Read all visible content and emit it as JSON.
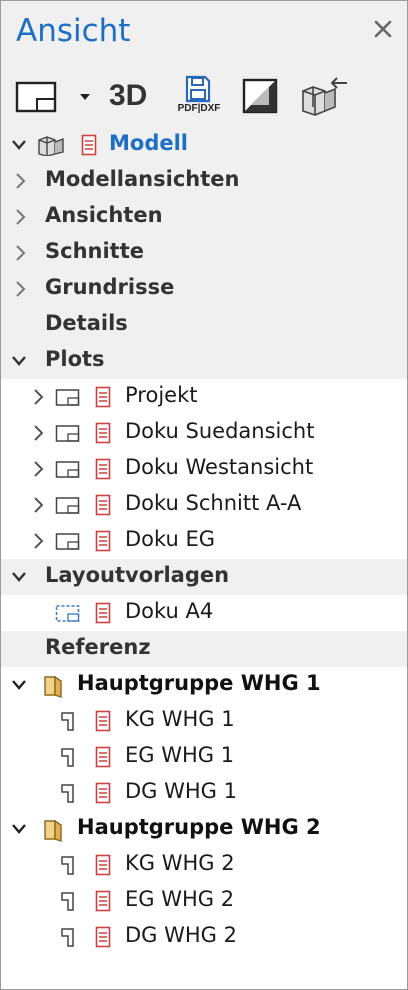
{
  "panel": {
    "title": "Ansicht",
    "close_icon": "close-icon"
  },
  "toolbar": {
    "layout_icon": "layout-view-icon",
    "dropdown_icon": "dropdown-arrow-icon",
    "view3d_label": "3D",
    "pdf_label": "PDF|DXF",
    "pdf_icon": "save-disk-icon",
    "contrast_icon": "contrast-icon",
    "model_export_icon": "model-export-icon"
  },
  "tree": {
    "modell": "Modell",
    "modellansichten": "Modellansichten",
    "ansichten": "Ansichten",
    "schnitte": "Schnitte",
    "grundrisse": "Grundrisse",
    "details": "Details",
    "plots": "Plots",
    "plot_items": [
      "Projekt",
      "Doku Suedansicht",
      "Doku Westansicht",
      "Doku Schnitt A-A",
      "Doku EG"
    ],
    "layoutvorlagen": "Layoutvorlagen",
    "layout_items": [
      "Doku A4"
    ],
    "referenz": "Referenz",
    "groups": [
      {
        "name": "Hauptgruppe WHG 1",
        "items": [
          "KG WHG 1",
          "EG WHG 1",
          "DG WHG 1"
        ]
      },
      {
        "name": "Hauptgruppe WHG 2",
        "items": [
          "KG WHG 2",
          "EG WHG 2",
          "DG WHG 2"
        ]
      }
    ]
  },
  "colors": {
    "accent": "#1e6ec8",
    "document_icon": "#d04040",
    "folder": "#e8c060"
  }
}
